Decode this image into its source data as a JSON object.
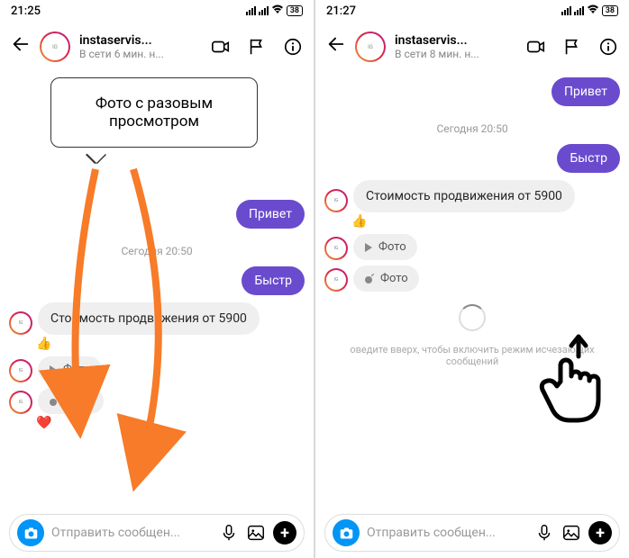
{
  "left": {
    "status_time": "21:25",
    "battery": "38",
    "username": "instaservis...",
    "presence": "В сети 6 мин. н...",
    "tooltip": "Фото с разовым просмотром",
    "msg_privet": "Привет",
    "timestamp": "Сегодня 20:50",
    "msg_bystr": "Быстр",
    "msg_price": "Стоимость продвижения от 5900",
    "reaction_thumb": "👍",
    "photo_label_1": "Фото",
    "photo_label_2": "Фото",
    "reaction_heart": "❤️",
    "input_placeholder": "Отправить сообщен..."
  },
  "right": {
    "status_time": "21:27",
    "battery": "38",
    "username": "instaservis...",
    "presence": "В сети 8 мин. н...",
    "msg_privet": "Привет",
    "timestamp": "Сегодня 20:50",
    "msg_bystr": "Быстр",
    "msg_price": "Стоимость продвижения от 5900",
    "reaction_thumb": "👍",
    "photo_label_1": "Фото",
    "photo_label_2": "Фото",
    "hint": "оведите вверх, чтобы включить режим исчезающих сообщений",
    "input_placeholder": "Отправить сообщен..."
  }
}
